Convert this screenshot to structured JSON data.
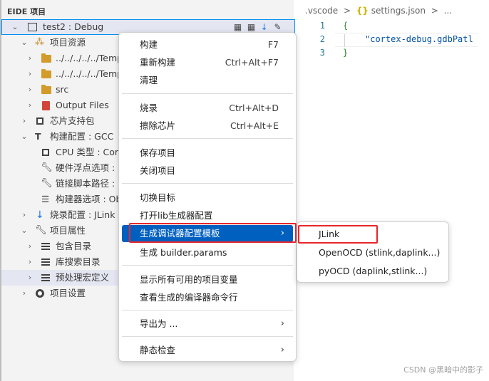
{
  "panel": {
    "title": "EIDE 项目",
    "project_row": {
      "label": "test2 : Debug"
    },
    "tree": [
      {
        "label": "项目资源",
        "icon": "resource-icon"
      },
      {
        "label": "../../../../../Templ",
        "icon": "folder-icon"
      },
      {
        "label": "../../../../../Templ",
        "icon": "folder-icon"
      },
      {
        "label": "src",
        "icon": "folder-icon"
      },
      {
        "label": "Output Files",
        "icon": "pdf-file-icon"
      },
      {
        "label": "芯片支持包",
        "icon": "chip-icon"
      },
      {
        "label": "构建配置 : GCC",
        "icon": "hammer-icon"
      },
      {
        "label": "CPU 类型 : Cort",
        "icon": "chip-icon"
      },
      {
        "label": "硬件浮点选项 :",
        "icon": "wrench-icon"
      },
      {
        "label": "链接脚本路径 :",
        "icon": "wrench-icon"
      },
      {
        "label": "构建器选项 : Ob",
        "icon": "list-edit-icon"
      },
      {
        "label": "烧录配置 : JLink",
        "icon": "download-arrow-icon"
      },
      {
        "label": "项目属性",
        "icon": "wrench-icon"
      },
      {
        "label": "包含目录",
        "icon": "list-icon"
      },
      {
        "label": "库搜索目录",
        "icon": "list-icon"
      },
      {
        "label": "预处理宏定义",
        "icon": "list-icon"
      },
      {
        "label": "项目设置",
        "icon": "gear-icon"
      }
    ]
  },
  "editor": {
    "breadcrumb": [
      ".vscode",
      ">",
      "{}",
      "settings.json",
      ">",
      "..."
    ],
    "lines": [
      {
        "no": "1",
        "text": "{"
      },
      {
        "no": "2",
        "text": "\"cortex-debug.gdbPatl"
      },
      {
        "no": "3",
        "text": "}"
      }
    ]
  },
  "context_menu": {
    "items": [
      {
        "label": "构建",
        "shortcut": "F7"
      },
      {
        "label": "重新构建",
        "shortcut": "Ctrl+Alt+F7"
      },
      {
        "label": "清理",
        "shortcut": ""
      },
      {
        "label": "烧录",
        "shortcut": "Ctrl+Alt+D"
      },
      {
        "label": "擦除芯片",
        "shortcut": "Ctrl+Alt+E"
      },
      {
        "label": "保存项目",
        "shortcut": ""
      },
      {
        "label": "关闭项目",
        "shortcut": ""
      },
      {
        "label": "切换目标",
        "shortcut": ""
      },
      {
        "label": "打开lib生成器配置",
        "shortcut": ""
      },
      {
        "label": "生成调试器配置模板",
        "shortcut": ""
      },
      {
        "label": "生成 builder.params",
        "shortcut": ""
      },
      {
        "label": "显示所有可用的项目变量",
        "shortcut": ""
      },
      {
        "label": "查看生成的编译器命令行",
        "shortcut": ""
      },
      {
        "label": "导出为 ...",
        "shortcut": ""
      },
      {
        "label": "静态检查",
        "shortcut": ""
      }
    ]
  },
  "submenu": {
    "items": [
      {
        "label": "JLink"
      },
      {
        "label": "OpenOCD (stlink,daplink...)"
      },
      {
        "label": "pyOCD (daplink,stlink...)"
      }
    ]
  },
  "watermark": "CSDN @黑暗中的影子",
  "colors": {
    "menu_active": "#0060c0",
    "highlight_box": "#e8262a",
    "sidebar_bg": "#f3f3f3"
  }
}
